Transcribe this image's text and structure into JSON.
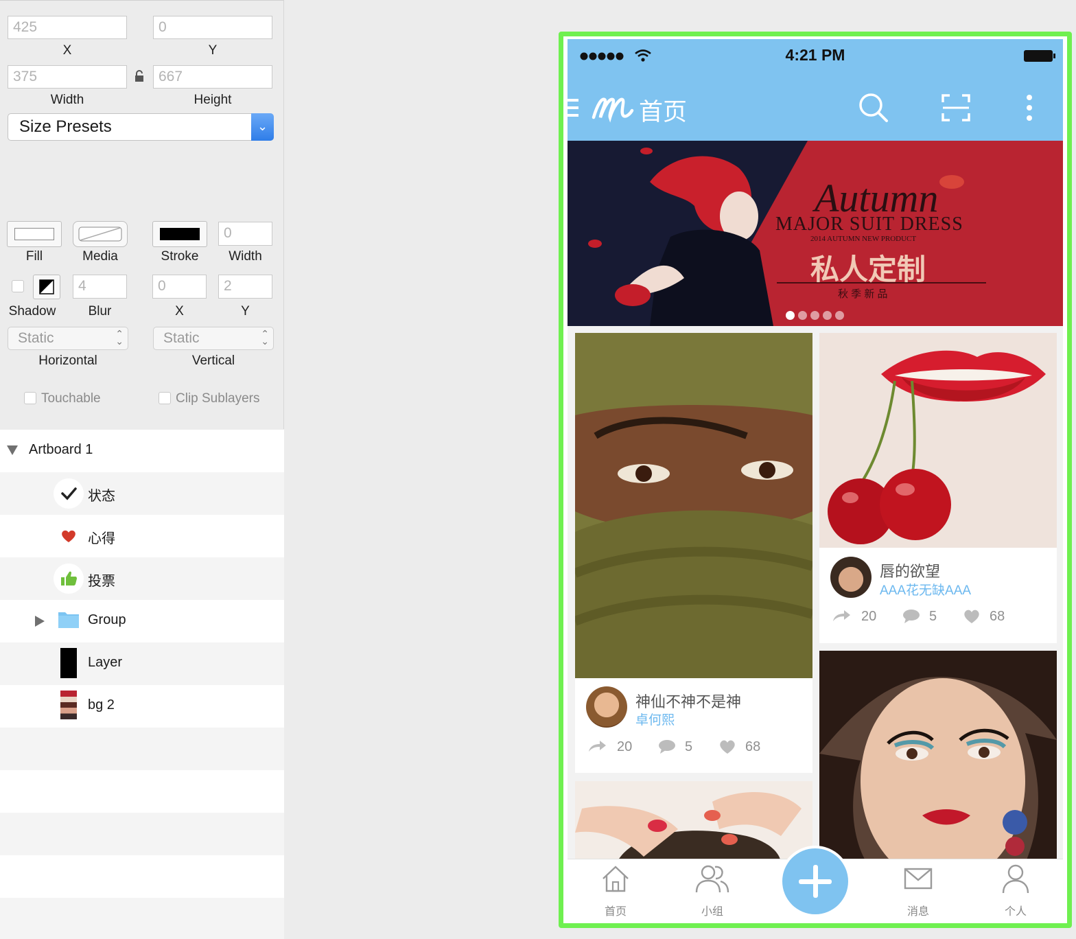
{
  "inspector": {
    "x_value": "425",
    "x_label": "X",
    "y_value": "0",
    "y_label": "Y",
    "width_value": "375",
    "width_label": "Width",
    "height_value": "667",
    "height_label": "Height",
    "size_presets": "Size Presets",
    "fill_label": "Fill",
    "media_label": "Media",
    "stroke_label": "Stroke",
    "stroke_width_value": "0",
    "stroke_width_label": "Width",
    "shadow_label": "Shadow",
    "blur_value": "4",
    "blur_label": "Blur",
    "shadow_x_value": "0",
    "shadow_x_label": "X",
    "shadow_y_value": "2",
    "shadow_y_label": "Y",
    "horizontal_value": "Static",
    "horizontal_label": "Horizontal",
    "vertical_value": "Static",
    "vertical_label": "Vertical",
    "touchable_label": "Touchable",
    "clip_label": "Clip Sublayers"
  },
  "layers": [
    {
      "name": "Artboard 1"
    },
    {
      "name": "状态"
    },
    {
      "name": "心得"
    },
    {
      "name": "投票"
    },
    {
      "name": "Group"
    },
    {
      "name": "Layer"
    },
    {
      "name": "bg 2"
    }
  ],
  "phone": {
    "time": "4:21 PM",
    "nav_title": "首页",
    "banner": {
      "script": "Autumn",
      "headline": "MAJOR SUIT DRESS",
      "sub": "2014 AUTUMN NEW PRODUCT",
      "cn_title": "私人定制",
      "cn_sub": "秋 季 新 品",
      "page_count": 5,
      "active_page": 1
    },
    "cards": [
      {
        "title": "神仙不神不是神",
        "author": "卓何熙",
        "shares": "20",
        "comments": "5",
        "likes": "68"
      },
      {
        "title": "唇的欲望",
        "author": "AAA花无缺AAA",
        "shares": "20",
        "comments": "5",
        "likes": "68"
      }
    ],
    "tabs": [
      {
        "label": "首页"
      },
      {
        "label": "小组"
      },
      {
        "label": "消息"
      },
      {
        "label": "个人"
      }
    ],
    "colors": {
      "accent": "#7fc3f0",
      "frame": "#6ff050",
      "banner_red": "#b92431",
      "banner_navy": "#171a33"
    }
  }
}
